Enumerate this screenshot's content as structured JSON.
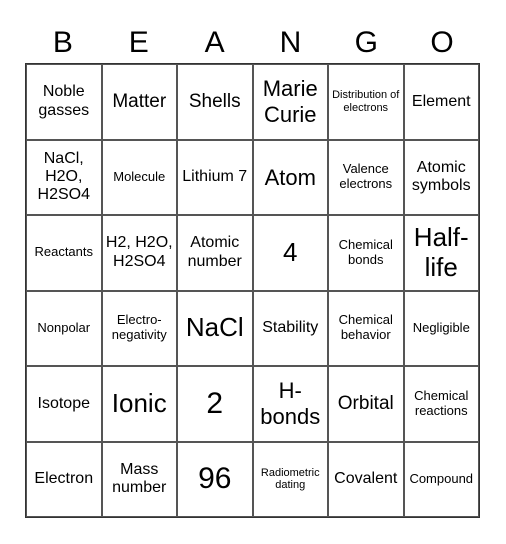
{
  "title_letters": [
    "B",
    "E",
    "A",
    "N",
    "G",
    "O"
  ],
  "rows": [
    [
      {
        "text": "Noble gasses",
        "size": "md"
      },
      {
        "text": "Matter",
        "size": "lg"
      },
      {
        "text": "Shells",
        "size": "lg"
      },
      {
        "text": "Marie Curie",
        "size": "xl"
      },
      {
        "text": "Distribution of electrons",
        "size": "xs"
      },
      {
        "text": "Element",
        "size": "md"
      }
    ],
    [
      {
        "text": "NaCl, H2O, H2SO4",
        "size": "md"
      },
      {
        "text": "Molecule",
        "size": "sm"
      },
      {
        "text": "Lithium 7",
        "size": "md"
      },
      {
        "text": "Atom",
        "size": "xl"
      },
      {
        "text": "Valence electrons",
        "size": "sm"
      },
      {
        "text": "Atomic symbols",
        "size": "md"
      }
    ],
    [
      {
        "text": "Reactants",
        "size": "sm"
      },
      {
        "text": "H2, H2O, H2SO4",
        "size": "md"
      },
      {
        "text": "Atomic number",
        "size": "md"
      },
      {
        "text": "4",
        "size": "xxl"
      },
      {
        "text": "Chemical bonds",
        "size": "sm"
      },
      {
        "text": "Half-life",
        "size": "xxl"
      }
    ],
    [
      {
        "text": "Nonpolar",
        "size": "sm"
      },
      {
        "text": "Electro-negativity",
        "size": "sm"
      },
      {
        "text": "NaCl",
        "size": "xxl"
      },
      {
        "text": "Stability",
        "size": "md"
      },
      {
        "text": "Chemical behavior",
        "size": "sm"
      },
      {
        "text": "Negligible",
        "size": "sm"
      }
    ],
    [
      {
        "text": "Isotope",
        "size": "md"
      },
      {
        "text": "Ionic",
        "size": "xxl"
      },
      {
        "text": "2",
        "size": "huge"
      },
      {
        "text": "H-bonds",
        "size": "xl"
      },
      {
        "text": "Orbital",
        "size": "lg"
      },
      {
        "text": "Chemical reactions",
        "size": "sm"
      }
    ],
    [
      {
        "text": "Electron",
        "size": "md"
      },
      {
        "text": "Mass number",
        "size": "md"
      },
      {
        "text": "96",
        "size": "huge"
      },
      {
        "text": "Radiometric dating",
        "size": "xs"
      },
      {
        "text": "Covalent",
        "size": "md"
      },
      {
        "text": "Compound",
        "size": "sm"
      }
    ]
  ]
}
